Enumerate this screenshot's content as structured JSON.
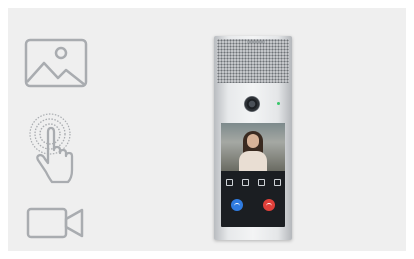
{
  "colors": {
    "background": "#efefef",
    "icon_stroke": "#a9acb0",
    "accept": "#2f7be0",
    "decline": "#e0403a",
    "led": "#38c66a"
  },
  "icons": [
    "image-icon",
    "tap-gesture-icon",
    "video-camera-icon"
  ],
  "device": {
    "screen_controls": [
      "",
      "",
      "",
      ""
    ],
    "call_buttons": [
      {
        "name": "answer-button",
        "color": "#2f7be0"
      },
      {
        "name": "decline-button",
        "color": "#e0403a"
      }
    ]
  }
}
